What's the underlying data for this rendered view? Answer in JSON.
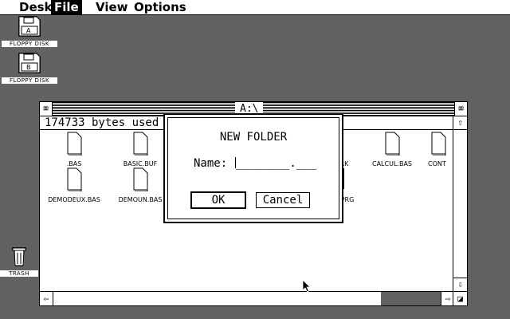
{
  "menubar": {
    "items": [
      {
        "label": "Desk",
        "active": false
      },
      {
        "label": "File",
        "active": true
      },
      {
        "label": "View",
        "active": false
      },
      {
        "label": "Options",
        "active": false
      }
    ]
  },
  "desktop": {
    "icons": [
      {
        "label": "FLOPPY DISK",
        "icon": "floppy-disk-icon"
      },
      {
        "label": "FLOPPY DISK",
        "icon": "floppy-disk-icon"
      },
      {
        "label": "TRASH",
        "icon": "trash-can-icon"
      }
    ]
  },
  "window": {
    "title": "A:\\",
    "info": "174733 bytes used i",
    "files": [
      {
        "label": ".BAS"
      },
      {
        "label": "BASIC.BUF"
      },
      {
        "label": "RK"
      },
      {
        "label": "CALCUL.BAS"
      },
      {
        "label": "CONT"
      },
      {
        "label": "DEMODEUX.BAS"
      },
      {
        "label": "DEMOUN.BAS"
      },
      {
        "label": "PRG"
      }
    ],
    "close_glyph": "⌧",
    "full_glyph": "⌧",
    "up_glyph": "⇧",
    "down_glyph": "⇩",
    "left_glyph": "⇦",
    "right_glyph": "⇨",
    "resize_glyph": "◪"
  },
  "dialog": {
    "title": "NEW FOLDER",
    "name_label": "Name:",
    "name_template": "________.___",
    "ok_label": "OK",
    "cancel_label": "Cancel"
  }
}
